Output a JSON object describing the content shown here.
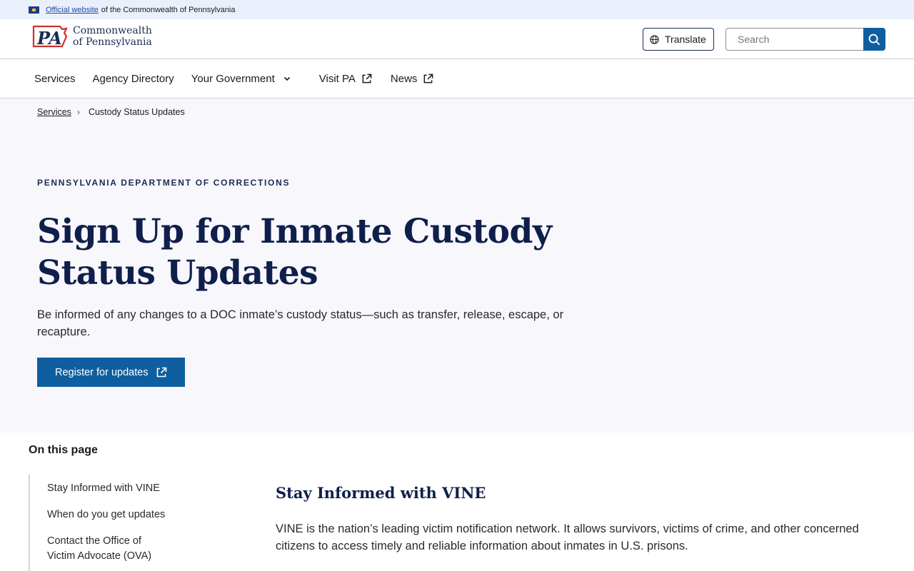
{
  "banner": {
    "link_text": "Official website",
    "rest_text": "of the Commonwealth of Pennsylvania"
  },
  "header": {
    "logo_mark": "PA",
    "logo_line1": "Commonwealth",
    "logo_line2": "of Pennsylvania",
    "translate_label": "Translate",
    "search_placeholder": "Search"
  },
  "nav": {
    "items": [
      {
        "label": "Services"
      },
      {
        "label": "Agency Directory"
      },
      {
        "label": "Your Government"
      },
      {
        "label": "Visit PA"
      },
      {
        "label": "News"
      }
    ]
  },
  "breadcrumb": {
    "items": [
      "Services",
      "Custody Status Updates"
    ]
  },
  "hero": {
    "eyebrow": "PENNSYLVANIA DEPARTMENT OF CORRECTIONS",
    "title": "Sign Up for Inmate Custody Status Updates",
    "lede": "Be informed of any changes to a DOC inmate’s custody status—such as transfer, release, escape, or recapture.",
    "cta_label": "Register for updates"
  },
  "on_this_page": {
    "title": "On this page",
    "items": [
      {
        "label": "Stay Informed with VINE"
      },
      {
        "label": "When do you get updates"
      },
      {
        "label": "Contact the Office of Victim Advocate (OVA)"
      }
    ]
  },
  "section": {
    "title": "Stay Informed with VINE",
    "body": "VINE is the nation’s leading victim notification network. It allows survivors, victims of crime, and other concerned citizens to access timely and reliable information about inmates in U.S. prisons."
  },
  "colors": {
    "primary": "#0f5fa0",
    "heading": "#0f1f4b",
    "hero_bg": "#f8f7fc",
    "banner_bg": "#eaf0fb",
    "logo_red": "#d0312d"
  }
}
